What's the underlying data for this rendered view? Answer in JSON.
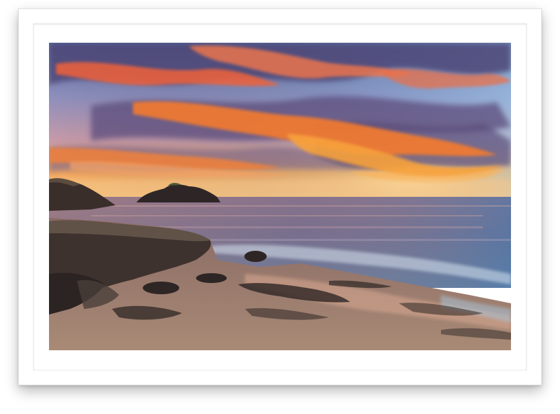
{
  "artwork": {
    "subject": "seascape-sunset",
    "frame_color": "#ffffff",
    "mat_color": "#ffffff",
    "palette": {
      "sky_top": "#5b7fb8",
      "sky_mid": "#9aa8d0",
      "horizon_glow": "#f6b15a",
      "cloud_fire": "#f06a2a",
      "cloud_purple": "#5a4a78",
      "sea": "#5a6f96",
      "sea_light": "#8fb3d6",
      "rock": "#3a302c",
      "sand": "#9a7a68"
    }
  }
}
